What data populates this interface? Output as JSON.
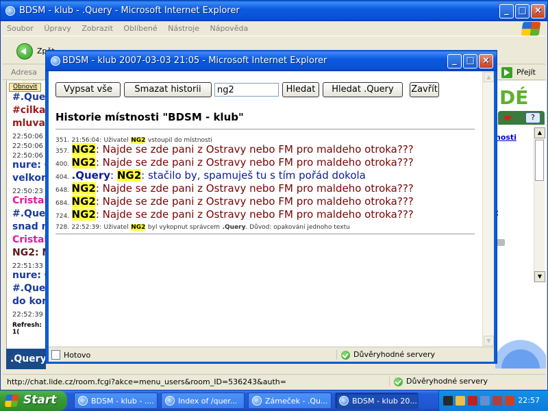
{
  "bg_window": {
    "title": "BDSM - klub - .Query - Microsoft Internet Explorer",
    "menu": [
      "Soubor",
      "Úpravy",
      "Zobrazit",
      "Oblíbené",
      "Nástroje",
      "Nápověda"
    ],
    "back_label": "Zpět",
    "address_label": "Adresa",
    "go_label": "Přejít",
    "status_url": "http://chat.lide.cz/room.fcgi?akce=menu_users&room_ID=536243&auth=",
    "zone_label": "Důvěryhodné servery",
    "refresh_button": "Obnovit",
    "chat_lines": [
      {
        "text": "#.Quer",
        "color": "#1a3a9a",
        "kind": "msg"
      },
      {
        "text": "#cilka1",
        "color": "#a01a1a",
        "kind": "msg"
      },
      {
        "text": "mluva.",
        "color": "#a01a1a",
        "kind": "msg"
      },
      {
        "text": "22:50:06",
        "kind": "ts"
      },
      {
        "text": "22:50:06",
        "kind": "ts"
      },
      {
        "text": "22:50:06",
        "kind": "ts"
      },
      {
        "text": "nure: C",
        "color": "#1a3a9a",
        "kind": "msg"
      },
      {
        "text": "velkom",
        "color": "#1a3a9a",
        "kind": "msg"
      },
      {
        "text": "22:50:23",
        "kind": "ts"
      },
      {
        "text": "Cristal",
        "color": "#e01a9a",
        "kind": "msg"
      },
      {
        "text": "#.Quer",
        "color": "#1a3a9a",
        "kind": "msg"
      },
      {
        "text": "snad n",
        "color": "#1a3a9a",
        "kind": "msg"
      },
      {
        "text": "Cristal",
        "color": "#e01a9a",
        "kind": "msg"
      },
      {
        "text": "NG2: N",
        "color": "#5a1a1a",
        "kind": "msg"
      },
      {
        "text": "22:51:33",
        "kind": "ts"
      },
      {
        "text": "nure: C",
        "color": "#1a3a9a",
        "kind": "msg"
      },
      {
        "text": "#.Quer",
        "color": "#1a3a9a",
        "kind": "msg"
      },
      {
        "text": "do kon",
        "color": "#1a3a9a",
        "kind": "msg"
      },
      {
        "text": "22:52:39",
        "kind": "ts"
      }
    ],
    "refresh_line": "Refresh: 1(",
    "bottom_label": ".Query",
    "right_logo": "DÉ",
    "right_link": "nosti",
    "right_big": ":"
  },
  "popup": {
    "title": "BDSM - klub 2007-03-03 21:05 - Microsoft Internet Explorer",
    "buttons": {
      "show_all": "Vypsat vše",
      "clear_history": "Smazat historii",
      "search": "Hledat",
      "search_query": "Hledat .Query",
      "close": "Zavřít"
    },
    "search_value": "ng2",
    "heading": "Historie místnosti \"BDSM - klub\"",
    "entries": [
      {
        "num": "351.",
        "time": "21:56:04:",
        "pre": "Uživatel",
        "nick": "NG2",
        "post": "vstoupil do místnosti"
      },
      {
        "num": "357.",
        "nick": "NG2",
        "msg": ": Najde se zde pani z Ostravy nebo FM pro maldeho otroka???"
      },
      {
        "num": "400.",
        "nick": "NG2",
        "msg": ": Najde se zde pani z Ostravy nebo FM pro maldeho otroka???"
      },
      {
        "num": "404.",
        "from": ".Query",
        "nick": "NG2",
        "msg": ": stačilo by, spamuješ tu s tím pořád dokola"
      },
      {
        "num": "648.",
        "nick": "NG2",
        "msg": ": Najde se zde pani z Ostravy nebo FM pro maldeho otroka???"
      },
      {
        "num": "684.",
        "nick": "NG2",
        "msg": ": Najde se zde pani z Ostravy nebo FM pro maldeho otroka???"
      },
      {
        "num": "724.",
        "nick": "NG2",
        "msg": ": Najde se zde pani z Ostravy nebo FM pro maldeho otroka???"
      },
      {
        "num": "728.",
        "time": "22:52:39:",
        "pre": "Uživatel",
        "nick": "NG2",
        "mid": "byl vykopnut správcem",
        "admin": ".Query",
        "post": ". Důvod: opakování jednoho textu"
      }
    ],
    "status_text": "Hotovo",
    "zone_label": "Důvěryhodné servery"
  },
  "taskbar": {
    "start": "Start",
    "tasks": [
      "BDSM - klub - ....",
      "Index of /quer...",
      "Zámeček - .Qu...",
      "BDSM - klub 20..."
    ],
    "clock": "22:57"
  }
}
